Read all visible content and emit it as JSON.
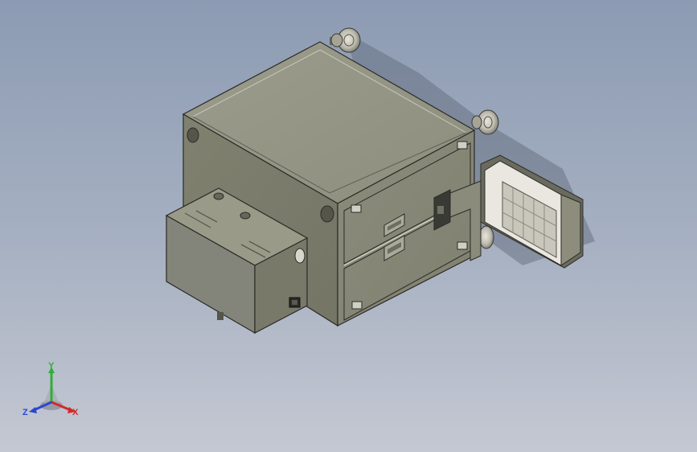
{
  "viewport": {
    "background_top": "#8c9bb3",
    "background_bottom": "#c4c8d2"
  },
  "model": {
    "body_color": "#8f9080",
    "edge_color": "#2b2b26",
    "door_interior_color": "#e9e7df"
  },
  "triad": {
    "x_label": "X",
    "y_label": "Y",
    "z_label": "Z",
    "x_color": "#d12a2a",
    "y_color": "#2fae3b",
    "z_color": "#2a46d1"
  }
}
